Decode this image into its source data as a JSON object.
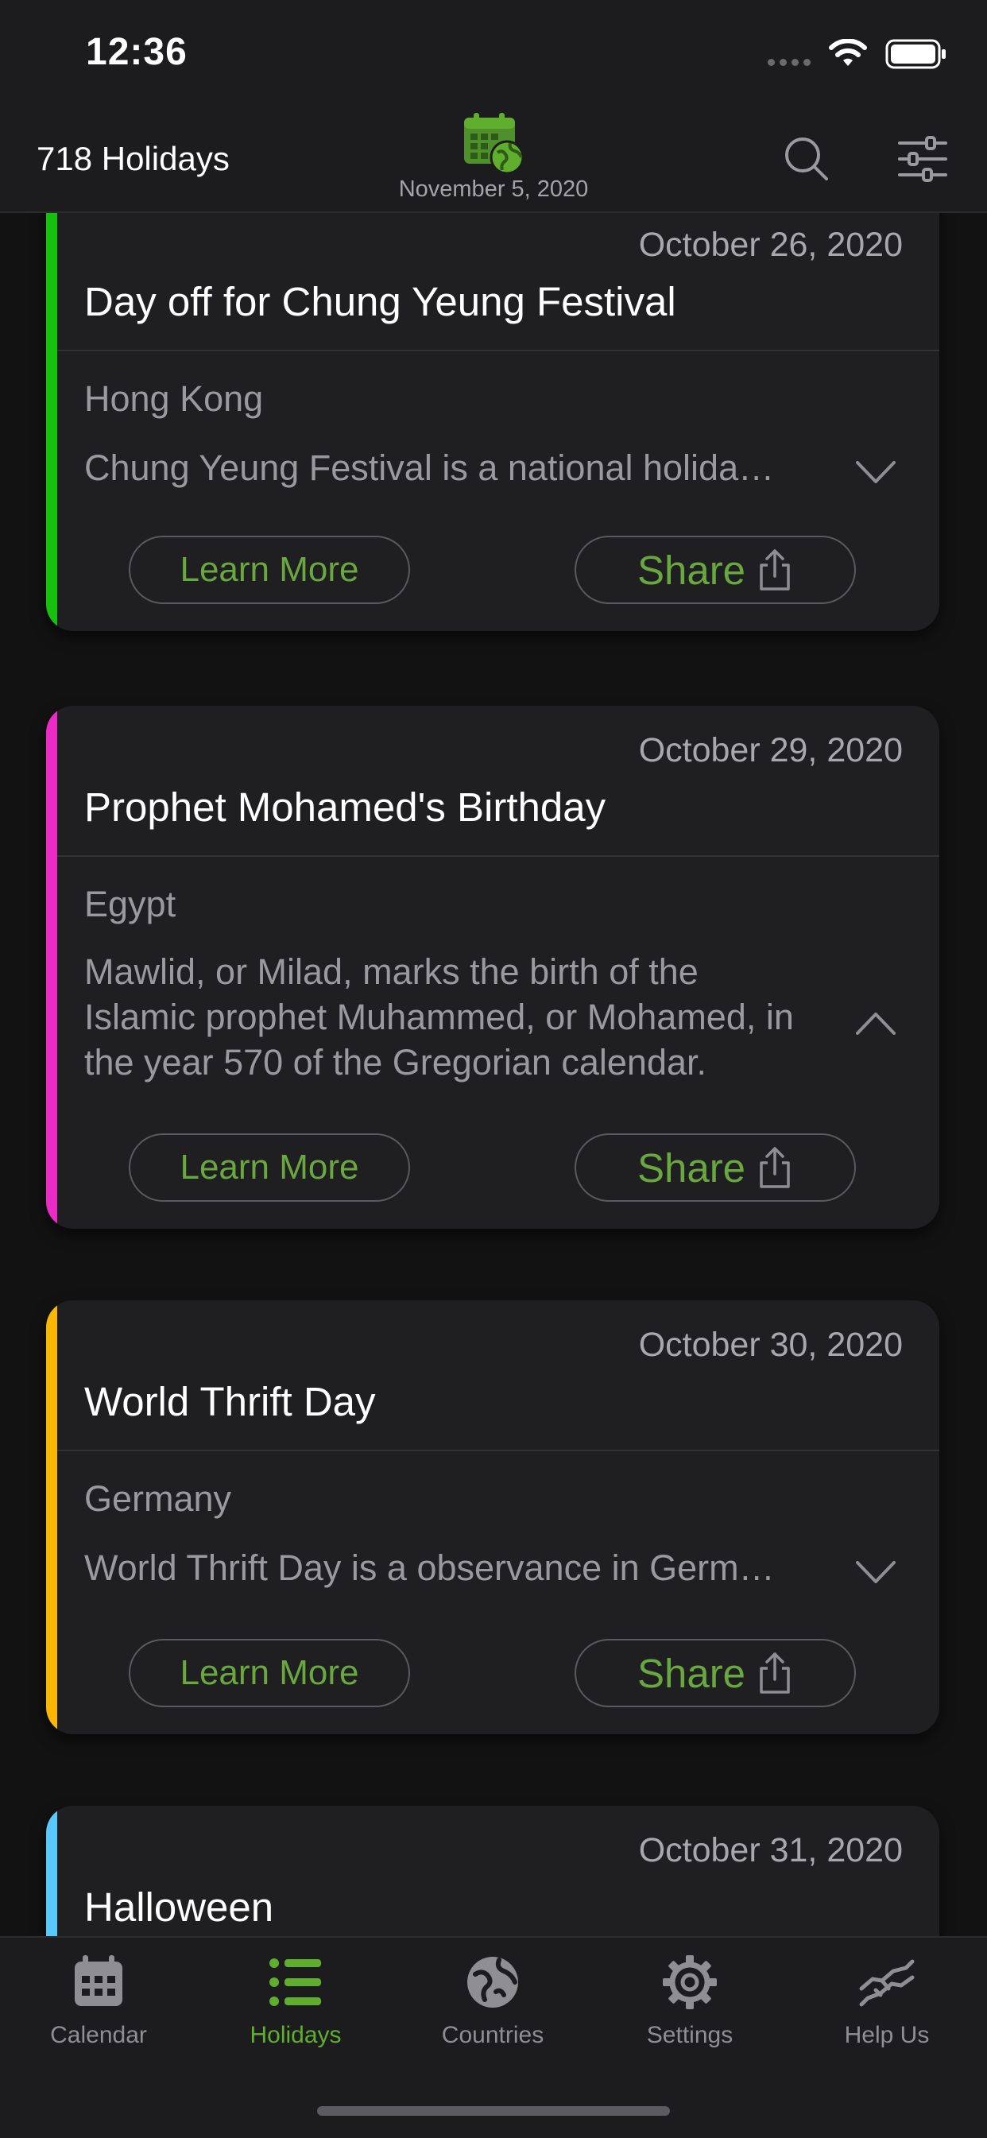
{
  "status_bar": {
    "time": "12:36"
  },
  "header": {
    "holiday_count": "718 Holidays",
    "current_date": "November 5, 2020",
    "logo_icon": "calendar-globe-icon",
    "search_icon": "search-icon",
    "filter_icon": "sliders-icon"
  },
  "colors": {
    "accent_green": "#5fae2e",
    "card_accent_1": "#17c00f",
    "card_accent_2": "#ea2bc4",
    "card_accent_3": "#f7b704",
    "card_accent_4": "#5ac8fa"
  },
  "cards": [
    {
      "date": "October 26, 2020",
      "title": "Day off for Chung Yeung Festival",
      "country": "Hong Kong",
      "description": "Chung Yeung Festival is a national holiday…",
      "expanded": false,
      "learn_more": "Learn More",
      "share": "Share"
    },
    {
      "date": "October 29, 2020",
      "title": "Prophet Mohamed's Birthday",
      "country": "Egypt",
      "description": "Mawlid, or Milad, marks the birth of the Islamic prophet Muhammed, or Mohamed, in the year 570 of the Gregorian calendar.",
      "expanded": true,
      "learn_more": "Learn More",
      "share": "Share"
    },
    {
      "date": "October 30, 2020",
      "title": "World Thrift Day",
      "country": "Germany",
      "description": "World Thrift Day is a observance in Germa…",
      "expanded": false,
      "learn_more": "Learn More",
      "share": "Share"
    },
    {
      "date": "October 31, 2020",
      "title": "Halloween"
    }
  ],
  "tabs": [
    {
      "label": "Calendar",
      "icon": "calendar-icon",
      "active": false
    },
    {
      "label": "Holidays",
      "icon": "list-icon",
      "active": true
    },
    {
      "label": "Countries",
      "icon": "globe-icon",
      "active": false
    },
    {
      "label": "Settings",
      "icon": "gear-icon",
      "active": false
    },
    {
      "label": "Help Us",
      "icon": "handshake-icon",
      "active": false
    }
  ]
}
